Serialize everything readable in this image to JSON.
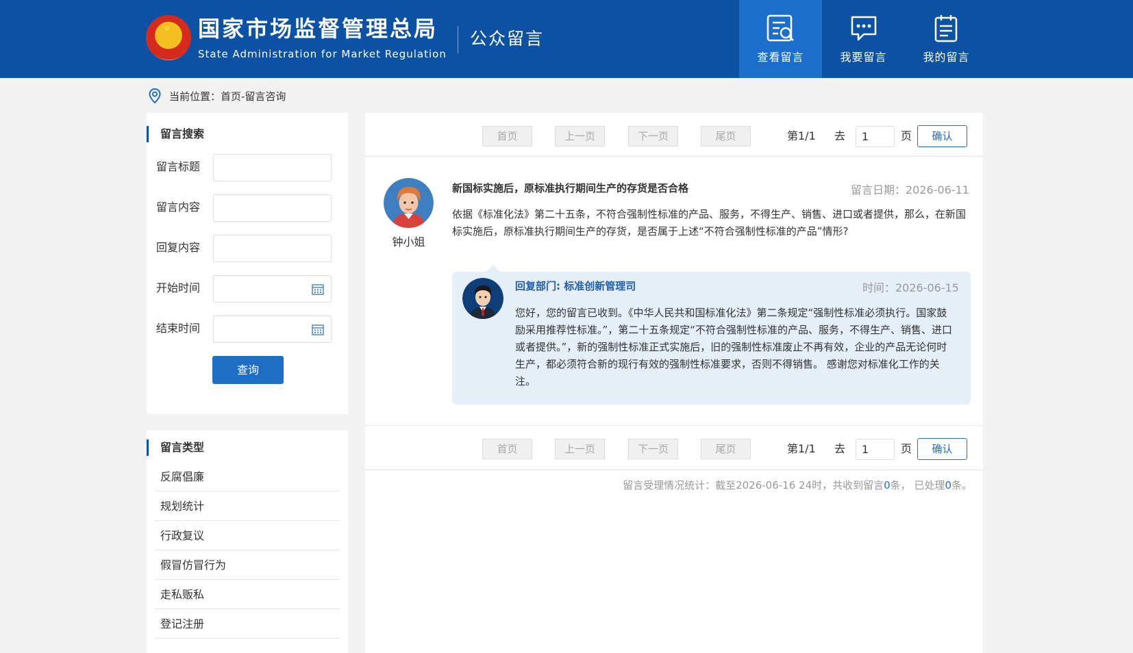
{
  "header": {
    "org_name_cn": "国家市场监督管理总局",
    "org_name_en": "State Administration for Market Regulation",
    "section_title": "公众留言",
    "nav": [
      {
        "label": "查看留言",
        "icon": "view-messages-icon",
        "active": true
      },
      {
        "label": "我要留言",
        "icon": "chat-bubble-icon",
        "active": false
      },
      {
        "label": "我的留言",
        "icon": "clipboard-icon",
        "active": false
      }
    ]
  },
  "breadcrumb": {
    "icon": "location-pin-icon",
    "text": "当前位置：首页-留言咨询"
  },
  "search": {
    "title": "留言搜索",
    "fields": [
      {
        "label": "留言标题",
        "value": "",
        "type": "text"
      },
      {
        "label": "留言内容",
        "value": "",
        "type": "text"
      },
      {
        "label": "回复内容",
        "value": "",
        "type": "text"
      },
      {
        "label": "开始时间",
        "value": "",
        "type": "date"
      },
      {
        "label": "结束时间",
        "value": "",
        "type": "date"
      }
    ],
    "button_label": "查询"
  },
  "types": {
    "title": "留言类型",
    "items": [
      "反腐倡廉",
      "规划统计",
      "行政复议",
      "假冒仿冒行为",
      "走私贩私",
      "登记注册"
    ]
  },
  "pager": {
    "first": "首页",
    "prev": "上一页",
    "next": "下一页",
    "last": "尾页",
    "page_info": "第1/1",
    "goto_label": "去",
    "page_input": "1",
    "page_unit": "页",
    "confirm": "确认"
  },
  "message": {
    "author": "钟小姐",
    "title": "新国标实施后，原标准执行期间生产的存货是否合格",
    "date": "留言日期：2026-06-11",
    "body": "依据《标准化法》第二十五条，不符合强制性标准的产品、服务，不得生产、销售、进口或者提供，那么，在新国标实施后，原标准执行期间生产的存货，是否属于上述“不符合强制性标准的产品”情形?",
    "reply": {
      "dept": "回复部门: 标准创新管理司",
      "time": "时间：2026-06-15",
      "body": "您好，您的留言已收到。《中华人民共和国标准化法》第二条规定“强制性标准必须执行。国家鼓励采用推荐性标准。”，第二十五条规定“不符合强制性标准的产品、服务，不得生产、销售、进口或者提供。”，新的强制性标准正式实施后，旧的强制性标准废止不再有效，企业的产品无论何时生产，都必须符合新的现行有效的强制性标准要求，否则不得销售。 感谢您对标准化工作的关注。"
    }
  },
  "stats": {
    "prefix": "留言受理情况统计：截至2026-06-16 24时，共收到留言",
    "received": "0",
    "mid": "条，  已处理",
    "processed": "0",
    "suffix": "条。"
  },
  "colors": {
    "header_bg": "#0b52a5",
    "nav_active_bg": "#1b6fcb",
    "accent": "#1f6ec6",
    "reply_bg": "#e6eef8"
  }
}
